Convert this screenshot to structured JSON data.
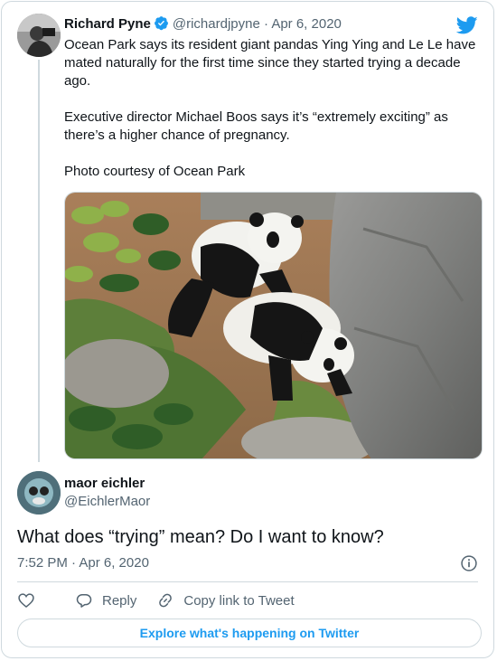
{
  "parent_tweet": {
    "author_name": "Richard Pyne",
    "handle": "@richardjpyne",
    "separator": "·",
    "date": "Apr 6, 2020",
    "paragraphs": [
      "Ocean Park says its resident giant pandas Ying Ying and Le Le have mated naturally for the first time since they started trying a decade ago.",
      "Executive director Michael Boos says it’s “extremely exciting” as there’s a higher chance of pregnancy.",
      "Photo courtesy of Ocean Park"
    ],
    "photo_icon": "photo-of-two-pandas"
  },
  "reply_tweet": {
    "author_name": "maor eichler",
    "handle": "@EichlerMaor",
    "text": "What does “trying” mean? Do I want to know?",
    "timestamp": "7:52 PM · Apr 6, 2020"
  },
  "actions": {
    "reply_label": "Reply",
    "copy_link_label": "Copy link to Tweet"
  },
  "explore_label": "Explore what's happening on Twitter",
  "colors": {
    "accent": "#1d9bf0",
    "text": "#0f1419",
    "secondary": "#536471",
    "border": "#cfd9de"
  },
  "icons": [
    "twitter-bird-icon",
    "verified-badge-icon",
    "info-icon",
    "heart-icon",
    "reply-icon",
    "link-icon"
  ]
}
